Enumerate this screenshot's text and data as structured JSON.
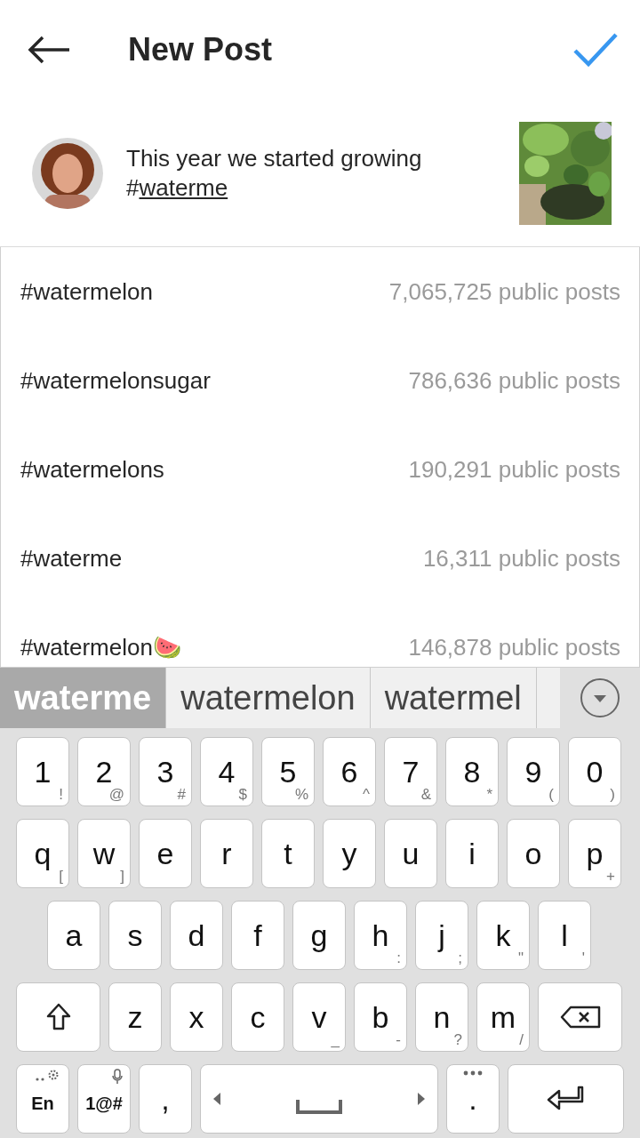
{
  "header": {
    "title": "New Post"
  },
  "composer": {
    "caption": "This year we started growing",
    "tag_prefix": "#",
    "tag_word": "waterme"
  },
  "hashtags": [
    {
      "tag": "#watermelon",
      "count": "7,065,725 public posts"
    },
    {
      "tag": "#watermelonsugar",
      "count": "786,636 public posts"
    },
    {
      "tag": "#watermelons",
      "count": "190,291 public posts"
    },
    {
      "tag": "#waterme",
      "count": "16,311 public posts"
    },
    {
      "tag": "#watermelon🍉",
      "count": "146,878 public posts"
    }
  ],
  "suggestions": [
    {
      "text": "waterme",
      "selected": true
    },
    {
      "text": "watermelon",
      "selected": false
    },
    {
      "text": "watermel",
      "selected": false
    }
  ],
  "keyboard": {
    "rows": [
      [
        {
          "kind": "char",
          "label": "1",
          "hint": "!"
        },
        {
          "kind": "char",
          "label": "2",
          "hint": "@"
        },
        {
          "kind": "char",
          "label": "3",
          "hint": "#"
        },
        {
          "kind": "char",
          "label": "4",
          "hint": "$"
        },
        {
          "kind": "char",
          "label": "5",
          "hint": "%"
        },
        {
          "kind": "char",
          "label": "6",
          "hint": "^"
        },
        {
          "kind": "char",
          "label": "7",
          "hint": "&"
        },
        {
          "kind": "char",
          "label": "8",
          "hint": "*"
        },
        {
          "kind": "char",
          "label": "9",
          "hint": "("
        },
        {
          "kind": "char",
          "label": "0",
          "hint": ")"
        }
      ],
      [
        {
          "kind": "char",
          "label": "q",
          "hint": "["
        },
        {
          "kind": "char",
          "label": "w",
          "hint": "]"
        },
        {
          "kind": "char",
          "label": "e"
        },
        {
          "kind": "char",
          "label": "r"
        },
        {
          "kind": "char",
          "label": "t"
        },
        {
          "kind": "char",
          "label": "y"
        },
        {
          "kind": "char",
          "label": "u"
        },
        {
          "kind": "char",
          "label": "i"
        },
        {
          "kind": "char",
          "label": "o"
        },
        {
          "kind": "char",
          "label": "p",
          "hint": "+"
        }
      ],
      [
        {
          "kind": "char",
          "label": "a"
        },
        {
          "kind": "char",
          "label": "s"
        },
        {
          "kind": "char",
          "label": "d"
        },
        {
          "kind": "char",
          "label": "f"
        },
        {
          "kind": "char",
          "label": "g"
        },
        {
          "kind": "char",
          "label": "h",
          "hint": ":"
        },
        {
          "kind": "char",
          "label": "j",
          "hint": ";"
        },
        {
          "kind": "char",
          "label": "k",
          "hint": "\""
        },
        {
          "kind": "char",
          "label": "l",
          "hint": "'"
        }
      ],
      [
        {
          "kind": "shift"
        },
        {
          "kind": "char",
          "label": "z"
        },
        {
          "kind": "char",
          "label": "x"
        },
        {
          "kind": "char",
          "label": "c"
        },
        {
          "kind": "char",
          "label": "v",
          "hint": "_"
        },
        {
          "kind": "char",
          "label": "b",
          "hint": "-"
        },
        {
          "kind": "char",
          "label": "n",
          "hint": "?"
        },
        {
          "kind": "char",
          "label": "m",
          "hint": "/"
        },
        {
          "kind": "backspace"
        }
      ],
      [
        {
          "kind": "lang",
          "label": "En"
        },
        {
          "kind": "symbols",
          "label": "1@#"
        },
        {
          "kind": "char",
          "label": ","
        },
        {
          "kind": "space"
        },
        {
          "kind": "period",
          "label": "."
        },
        {
          "kind": "enter"
        }
      ]
    ]
  }
}
